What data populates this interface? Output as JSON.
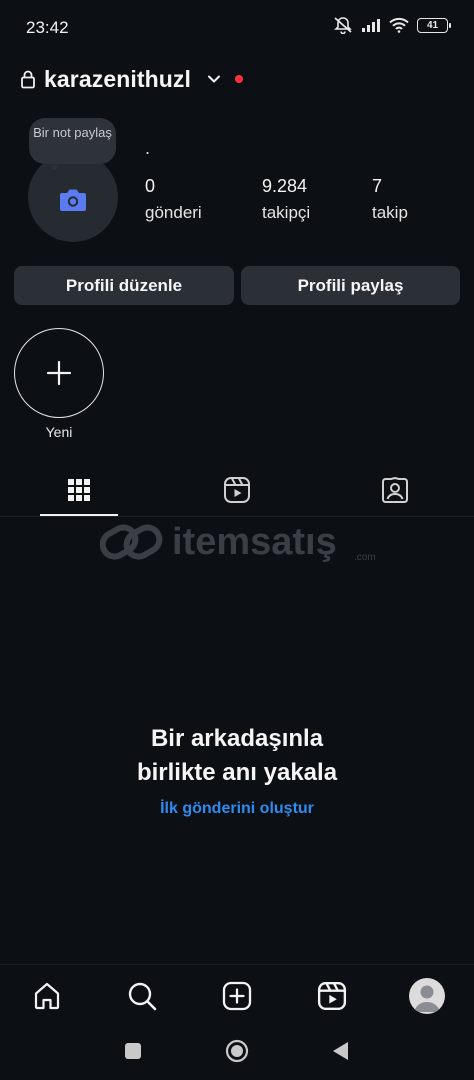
{
  "status_bar": {
    "time": "23:42",
    "battery": "41"
  },
  "header": {
    "username": "karazenithuzl"
  },
  "profile": {
    "note_text": "Bir not paylaş",
    "name": ".",
    "stats": [
      {
        "value": "0",
        "label": "gönderi"
      },
      {
        "value": "9.284",
        "label": "takipçi"
      },
      {
        "value": "7",
        "label": "takip"
      }
    ]
  },
  "actions": {
    "edit_label": "Profili düzenle",
    "share_label": "Profili paylaş"
  },
  "highlights": {
    "new_label": "Yeni"
  },
  "tabs": [
    {
      "icon": "grid-icon",
      "active": true
    },
    {
      "icon": "reels-icon",
      "active": false
    },
    {
      "icon": "tagged-icon",
      "active": false
    }
  ],
  "watermark": {
    "text": "itemsatış",
    "suffix": ".com"
  },
  "empty_state": {
    "title_line1": "Bir arkadaşınla",
    "title_line2": "birlikte anı yakala",
    "link": "İlk gönderini oluştur"
  },
  "bottom_nav": [
    "home-icon",
    "search-icon",
    "create-icon",
    "reels-icon",
    "profile-icon"
  ],
  "colors": {
    "background": "#0c0f14",
    "button": "#2b2f36",
    "link": "#2f8bee",
    "notification_dot": "#ff3040",
    "camera_accent": "#5b7cf0"
  }
}
